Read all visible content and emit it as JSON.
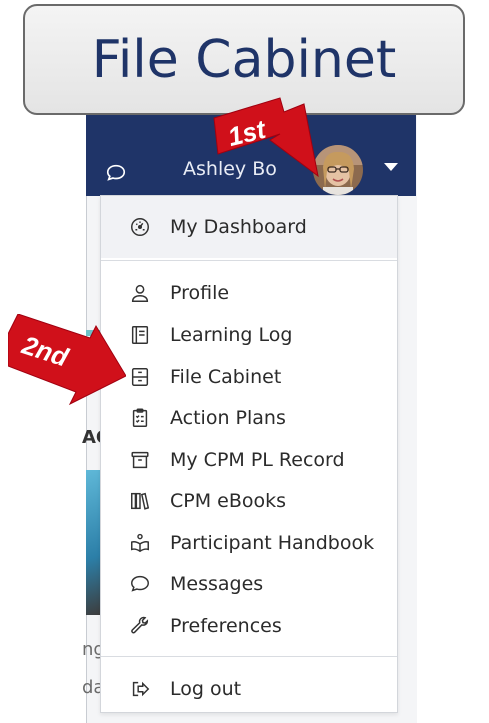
{
  "title": "File Cabinet",
  "navbar": {
    "username": "Ashley Bo",
    "colors": {
      "bg": "#1f3468",
      "text": "#ffffff"
    },
    "icons": {
      "chat": "chat-bubble-icon",
      "caret": "caret-down-icon"
    }
  },
  "background": {
    "text_fragments": [
      "AC",
      "ng",
      "da"
    ]
  },
  "menu": {
    "items": [
      {
        "label": "My Dashboard",
        "icon": "dashboard-gauge-icon"
      },
      {
        "label": "Profile",
        "icon": "person-icon"
      },
      {
        "label": "Learning Log",
        "icon": "notebook-icon"
      },
      {
        "label": "File Cabinet",
        "icon": "file-cabinet-icon"
      },
      {
        "label": "Action Plans",
        "icon": "clipboard-checklist-icon"
      },
      {
        "label": "My CPM PL Record",
        "icon": "archive-box-icon"
      },
      {
        "label": "CPM eBooks",
        "icon": "books-icon"
      },
      {
        "label": "Participant Handbook",
        "icon": "handbook-icon"
      },
      {
        "label": "Messages",
        "icon": "chat-bubble-icon"
      },
      {
        "label": "Preferences",
        "icon": "wrench-icon"
      },
      {
        "label": "Log out",
        "icon": "logout-icon"
      }
    ]
  },
  "annotations": {
    "first": "1st",
    "second": "2nd",
    "color": "#d0101a"
  }
}
